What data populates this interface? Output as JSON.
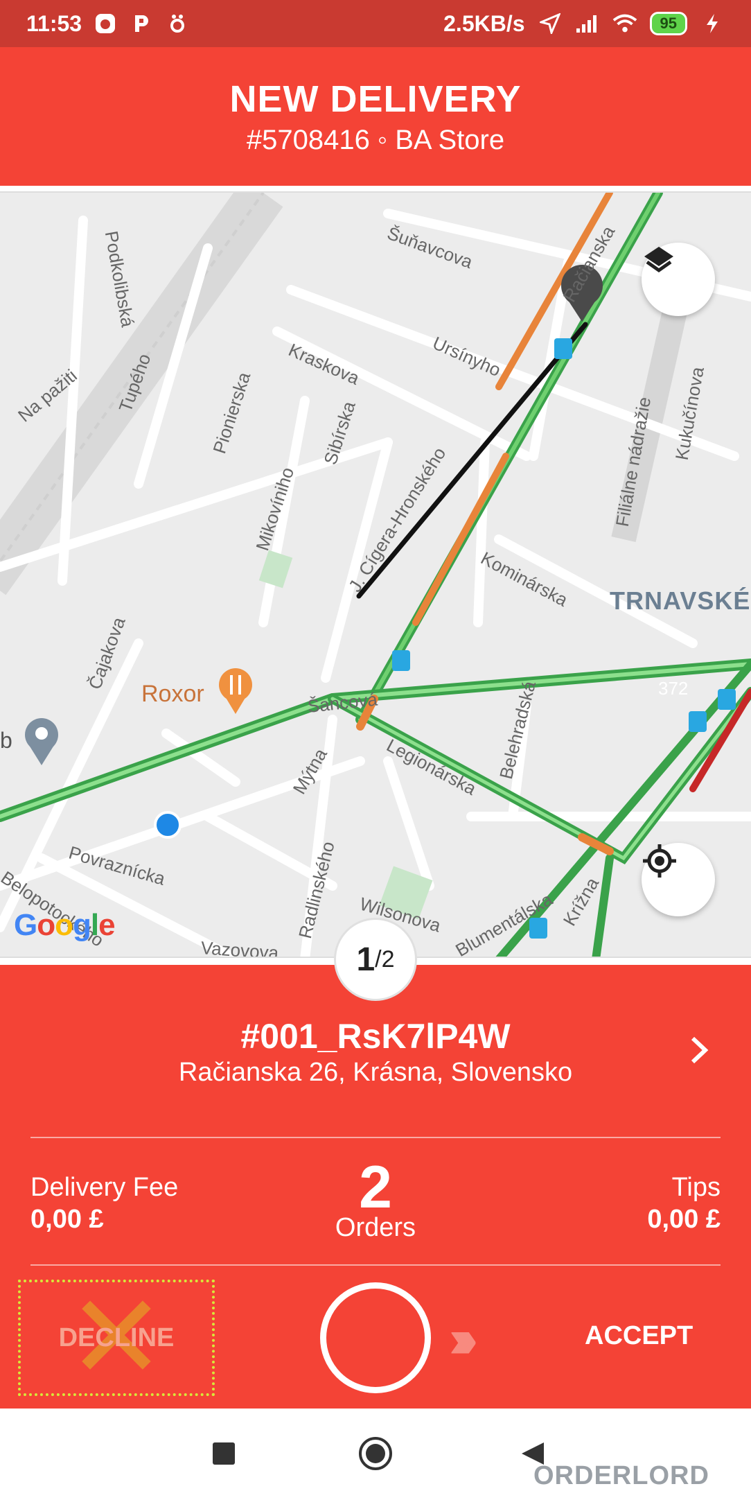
{
  "status_bar": {
    "time": "11:53",
    "speed": "2.5KB/s",
    "battery": "95",
    "icons": [
      "app-notification-icon",
      "parking-icon",
      "tracking-icon",
      "location-arrow-icon",
      "signal-icon",
      "wifi-icon",
      "charging-icon"
    ]
  },
  "header": {
    "title": "NEW DELIVERY",
    "subtitle": "#5708416 ◦ BA Store"
  },
  "map": {
    "streets": [
      "Podkolibská",
      "Šuňavcova",
      "Tupého",
      "Na pažiti",
      "Kraskova",
      "Ursínyho",
      "Pionierska",
      "Sibírska",
      "Mikovíniho",
      "Kukučínova",
      "Filiálne nádražie",
      "J. Cígera-Hronského",
      "Kominárska",
      "Čajakova",
      "Šancová",
      "Legionárska",
      "Belehradská",
      "Mýtna",
      "Povraznícka",
      "Belopotockého",
      "Radlinského",
      "Wilsonova",
      "Vazovova",
      "Blumentálska",
      "Krížna",
      "Račianska",
      "372"
    ],
    "district": "TRNAVSKÉ",
    "poi": "Roxor",
    "poi_prefix": "b",
    "google": [
      "G",
      "o",
      "o",
      "g",
      "l",
      "e"
    ]
  },
  "pager": {
    "current": "1",
    "total": "/2"
  },
  "order": {
    "id": "#001_RsK7lP4W",
    "address": "Račianska 26, Krásna, Slovensko",
    "delivery_fee_label": "Delivery Fee",
    "delivery_fee_value": "0,00 £",
    "tips_label": "Tips",
    "tips_value": "0,00 £",
    "orders_count": "2",
    "orders_label": "Orders"
  },
  "actions": {
    "decline": "DECLINE",
    "accept": "ACCEPT",
    "arrows": "›››"
  },
  "watermark": "ORDERLORD",
  "colors": {
    "brand_red": "#f44336",
    "status_red": "#c93a31",
    "traffic_green": "#4caf50",
    "traffic_orange": "#e8843a"
  }
}
